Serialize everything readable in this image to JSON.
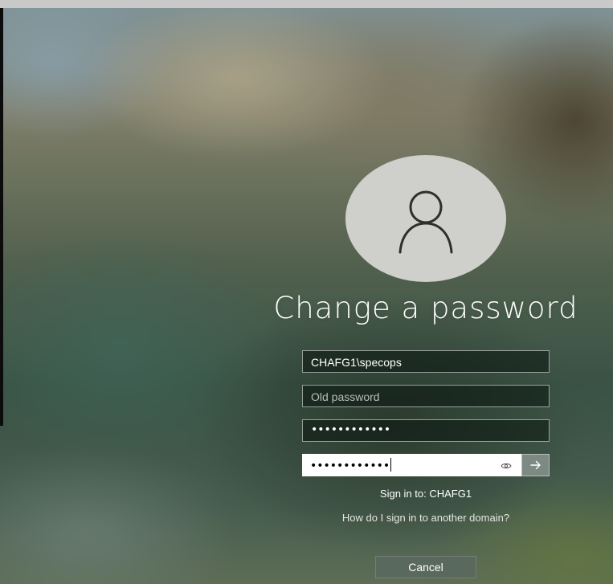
{
  "page": {
    "title": "Change a password"
  },
  "avatar": {
    "icon": "user-icon"
  },
  "fields": {
    "username": {
      "value": "CHAFG1\\specops"
    },
    "old_password": {
      "placeholder": "Old password",
      "value": ""
    },
    "new_password": {
      "masked_value": "••••••••••••"
    },
    "confirm_password": {
      "masked_value": "••••••••••••",
      "reveal_icon": "eye-icon",
      "submit_icon": "arrow-right-icon"
    }
  },
  "signin": {
    "text": "Sign in to: CHAFG1"
  },
  "links": {
    "other_domain": "How do I sign in to another domain?"
  },
  "buttons": {
    "cancel": "Cancel"
  },
  "colors": {
    "field_background": "#14201a",
    "submit_background": "#7d8a84",
    "avatar_background": "#cfcfcb"
  }
}
